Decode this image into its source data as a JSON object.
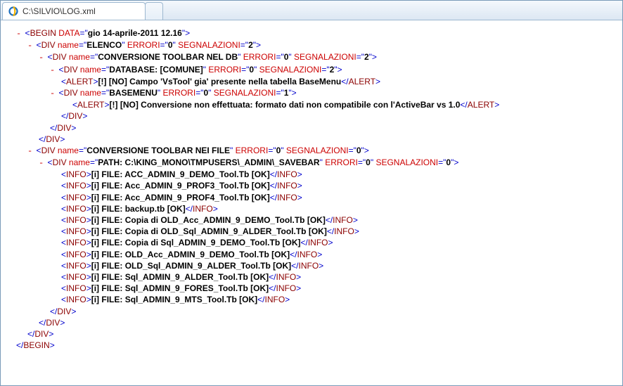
{
  "tab": {
    "title": "C:\\SILVIO\\LOG.xml"
  },
  "begin": {
    "data": "gio 14-aprile-2011 12.16"
  },
  "elenco": {
    "name": "ELENCO",
    "errori": "0",
    "segnalazioni": "2"
  },
  "convDb": {
    "name": "CONVERSIONE TOOLBAR NEL DB",
    "errori": "0",
    "segnalazioni": "2"
  },
  "database": {
    "name": "DATABASE: [COMUNE]",
    "errori": "0",
    "segnalazioni": "2"
  },
  "alert1": "[!] [NO] Campo 'VsTool' gia' presente nella tabella BaseMenu",
  "basemenu": {
    "name": "BASEMENU",
    "errori": "0",
    "segnalazioni": "1"
  },
  "alert2": "[!] [NO] Conversione non effettuata: formato dati non compatibile con l'ActiveBar vs 1.0",
  "convFile": {
    "name": "CONVERSIONE TOOLBAR NEI FILE",
    "errori": "0",
    "segnalazioni": "0"
  },
  "path": {
    "name": "PATH: C:\\KING_MONO\\TMPUSERS\\_ADMIN\\_SAVEBAR",
    "errori": "0",
    "segnalazioni": "0"
  },
  "info": [
    "[i] FILE: ACC_ADMIN_9_DEMO_Tool.Tb [OK]",
    "[i] FILE: Acc_ADMIN_9_PROF3_Tool.Tb [OK]",
    "[i] FILE: Acc_ADMIN_9_PROF4_Tool.Tb [OK]",
    "[i] FILE: backup.tb [OK]",
    "[i] FILE: Copia di OLD_Acc_ADMIN_9_DEMO_Tool.Tb [OK]",
    "[i] FILE: Copia di OLD_Sql_ADMIN_9_ALDER_Tool.Tb [OK]",
    "[i] FILE: Copia di Sql_ADMIN_9_DEMO_Tool.Tb [OK]",
    "[i] FILE: OLD_Acc_ADMIN_9_DEMO_Tool.Tb [OK]",
    "[i] FILE: OLD_Sql_ADMIN_9_ALDER_Tool.Tb [OK]",
    "[i] FILE: Sql_ADMIN_9_ALDER_Tool.Tb [OK]",
    "[i] FILE: Sql_ADMIN_9_FORES_Tool.Tb [OK]",
    "[i] FILE: Sql_ADMIN_9_MTS_Tool.Tb [OK]"
  ],
  "colors": {
    "tag": "#8b0000",
    "attr": "#c00",
    "punct": "#0000cc"
  }
}
